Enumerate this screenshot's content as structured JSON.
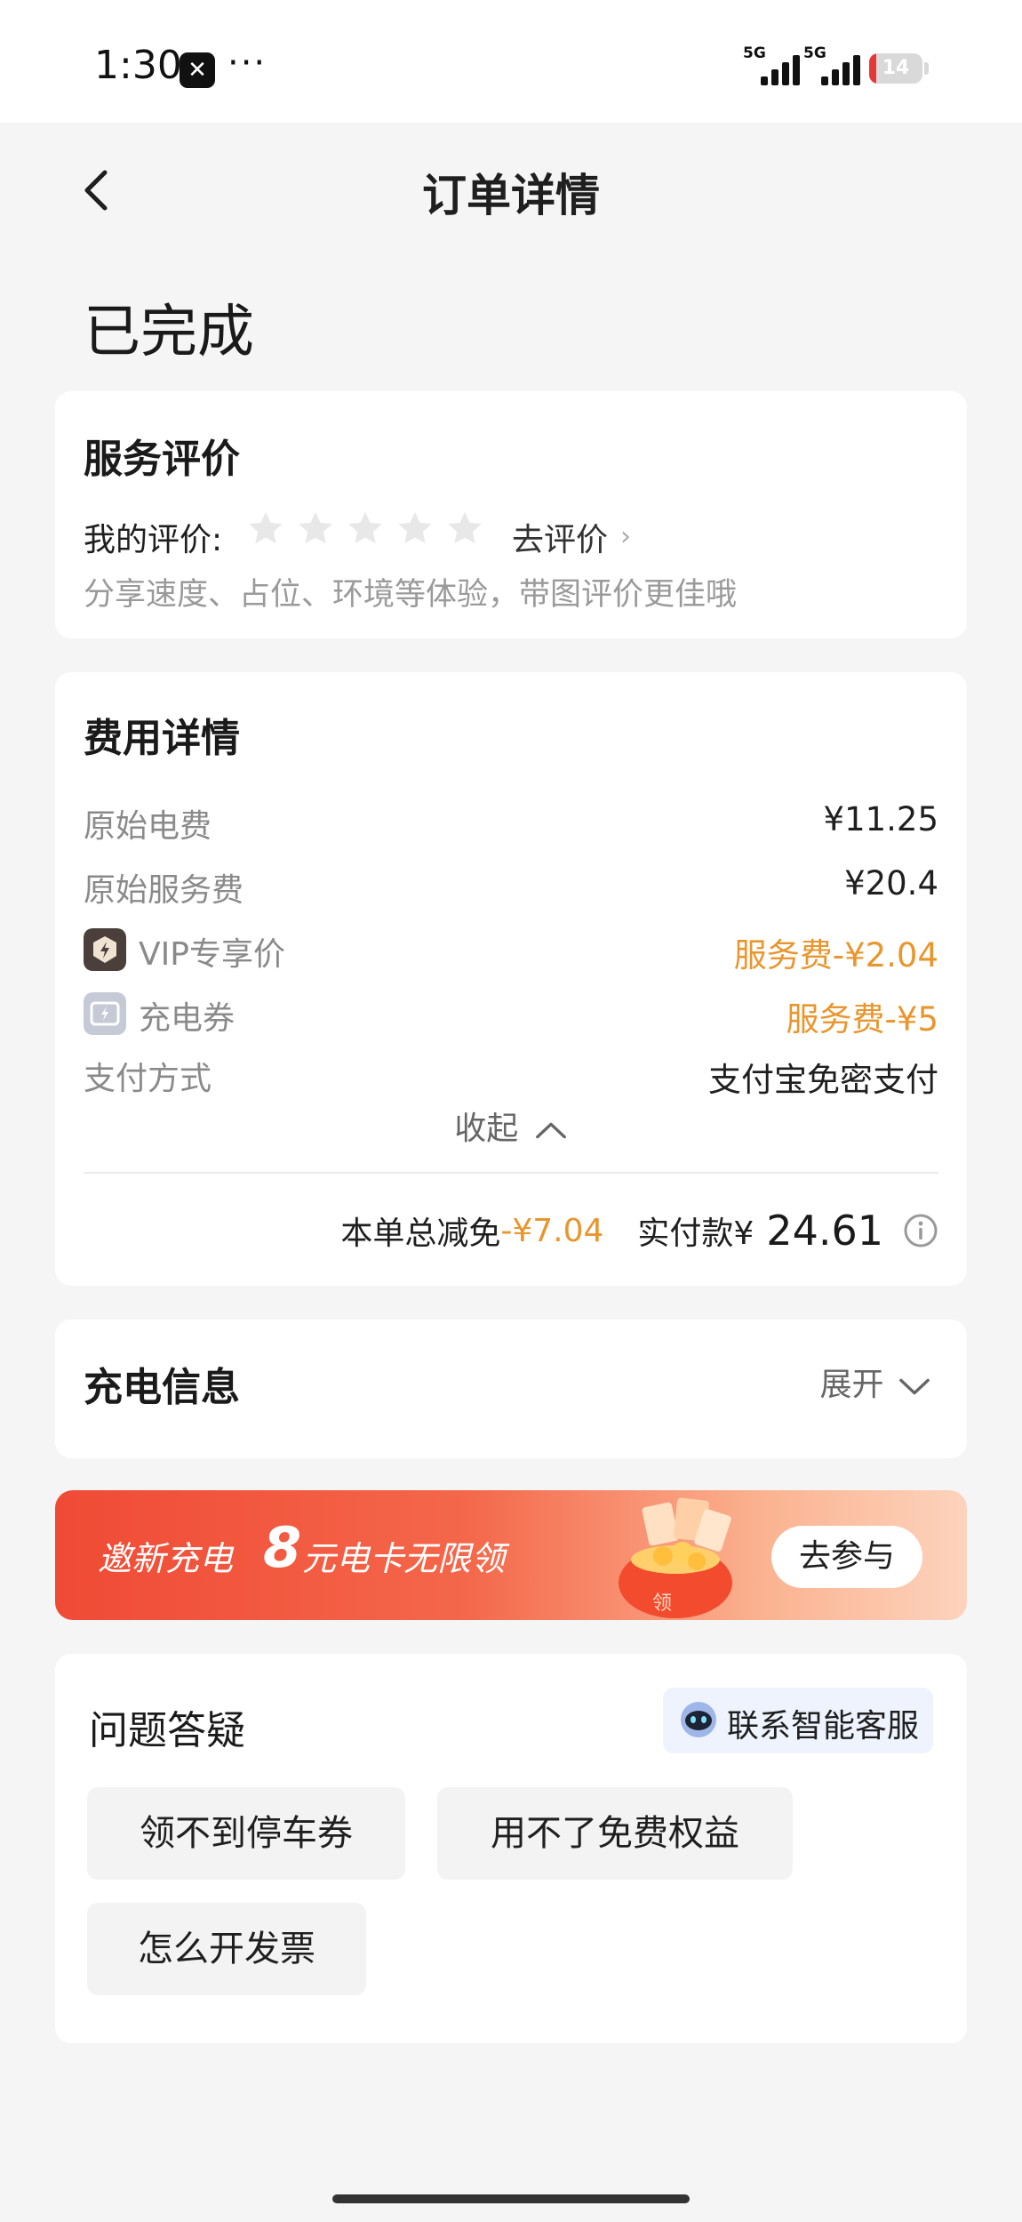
{
  "status_bar": {
    "time": "1:30",
    "app_icon_glyph": "✕",
    "dots": "···",
    "network1": "5G",
    "network2": "5G",
    "battery": "14",
    "battery_level": 0.14
  },
  "nav": {
    "title": "订单详情"
  },
  "order_status": "已完成",
  "rating": {
    "title": "服务评价",
    "label": "我的评价:",
    "stars_total": 5,
    "stars_filled": 0,
    "go_rate": "去评价",
    "hint": "分享速度、占位、环境等体验，带图评价更佳哦"
  },
  "fee": {
    "title": "费用详情",
    "rows": [
      {
        "label": "原始电费",
        "value": "¥11.25"
      },
      {
        "label": "原始服务费",
        "value": "¥20.4"
      },
      {
        "label": "VIP专享价",
        "value": "服务费-¥2.04"
      },
      {
        "label": "充电券",
        "value": "服务费-¥5"
      },
      {
        "label": "支付方式",
        "value": "支付宝免密支付"
      }
    ],
    "collapse": "收起",
    "total_discount_label": "本单总减免",
    "total_discount_value": "-¥7.04",
    "paid_label": "实付款¥",
    "paid_value": "24.61"
  },
  "charge_info": {
    "title": "充电信息",
    "expand": "展开"
  },
  "banner": {
    "text_prefix": "邀新充电",
    "amount": "8",
    "text_suffix": "元电卡无限领",
    "button": "去参与",
    "gift_char": "领"
  },
  "faq": {
    "title": "问题答疑",
    "cs_button": "联系智能客服",
    "chips": [
      "领不到停车券",
      "用不了免费权益",
      "怎么开发票"
    ]
  },
  "colors": {
    "accent_orange": "#e8962d",
    "banner_red": "#f04a35",
    "background": "#f5f5f5"
  },
  "icons": [
    "back-icon",
    "star-icon",
    "chevron-right-icon",
    "vip-icon",
    "coupon-icon",
    "chevron-up-icon",
    "info-icon",
    "chevron-down-icon",
    "robot-icon"
  ]
}
